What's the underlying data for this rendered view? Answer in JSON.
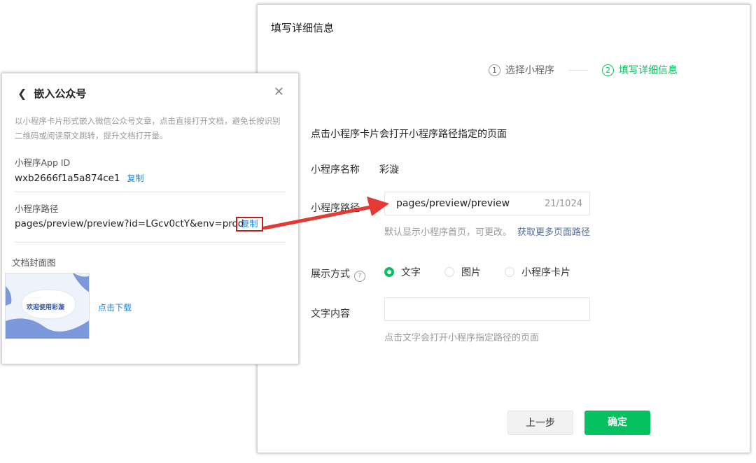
{
  "right": {
    "title": "填写详细信息",
    "steps": [
      {
        "num": "1",
        "label": "选择小程序"
      },
      {
        "num": "2",
        "label": "填写详细信息"
      }
    ],
    "desc": "点击小程序卡片会打开小程序路径指定的页面",
    "name_label": "小程序名称",
    "name_value": "彩漩",
    "path_label": "小程序路径",
    "path_value": "pages/preview/preview",
    "path_count": "21/1024",
    "path_hint": "默认显示小程序首页，可更改。",
    "path_link": "获取更多页面路径",
    "display_label": "展示方式",
    "display_options": [
      "文字",
      "图片",
      "小程序卡片"
    ],
    "display_selected": "文字",
    "text_label": "文字内容",
    "text_value": "",
    "text_hint": "点击文字会打开小程序指定路径的页面",
    "prev_button": "上一步",
    "ok_button": "确定"
  },
  "left": {
    "title": "嵌入公众号",
    "desc": "以小程序卡片形式嵌入微信公众号文章，点击直接打开文档，避免长按识别二维码或阅读原文跳转，提升文档打开量。",
    "appid_label": "小程序App ID",
    "appid_value": "wxb2666f1a5a874ce1",
    "copy": "复制",
    "path_label": "小程序路径",
    "path_value": "pages/preview/preview?id=LGcv0ctY&env=prod",
    "cover_label": "文档封面图",
    "cover_text": "欢迎使用彩漩",
    "download": "点击下载"
  },
  "colors": {
    "accent": "#07c160",
    "link": "#1e86d6",
    "highlight": "#c0201c",
    "arrow": "#e53935"
  },
  "icons": {
    "back": "chevron-left-icon",
    "close": "close-icon",
    "help": "question-circle-icon"
  }
}
